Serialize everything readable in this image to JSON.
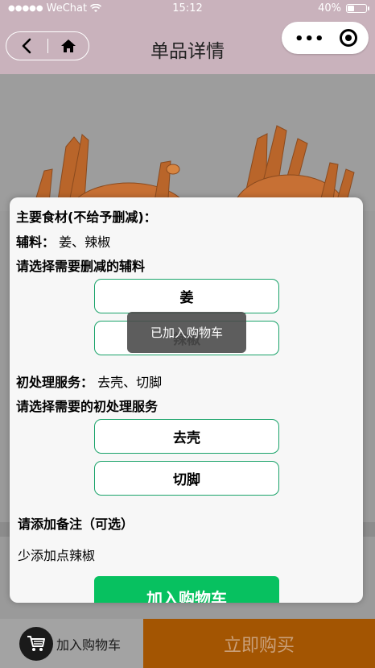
{
  "status_bar": {
    "carrier": "WeChat",
    "time": "15:12",
    "battery": "40%",
    "battery_level": 0.4
  },
  "nav": {
    "title": "单品详情"
  },
  "modal": {
    "main_ingredients_label": "主要食材(不给予删减)：",
    "auxiliary_label": "辅料：",
    "auxiliary_value": "姜、辣椒",
    "choose_remove_label": "请选择需要删减的辅料",
    "aux_options": [
      "姜",
      "辣椒"
    ],
    "service_label": "初处理服务：",
    "service_value": "去壳、切脚",
    "choose_service_label": "请选择需要的初处理服务",
    "service_options": [
      "去壳",
      "切脚"
    ],
    "remark_label": "请添加备注（可选）",
    "remark_value": "少添加点辣椒",
    "add_cart_label": "加入购物车"
  },
  "toast": {
    "text": "已加入购物车"
  },
  "bottom_bar": {
    "cart_label": "加入购物车",
    "buy_label": "立即购买"
  },
  "colors": {
    "nav_bg": "#c9b2bc",
    "accent_green": "#07c160",
    "buy_bg": "#a35502"
  }
}
